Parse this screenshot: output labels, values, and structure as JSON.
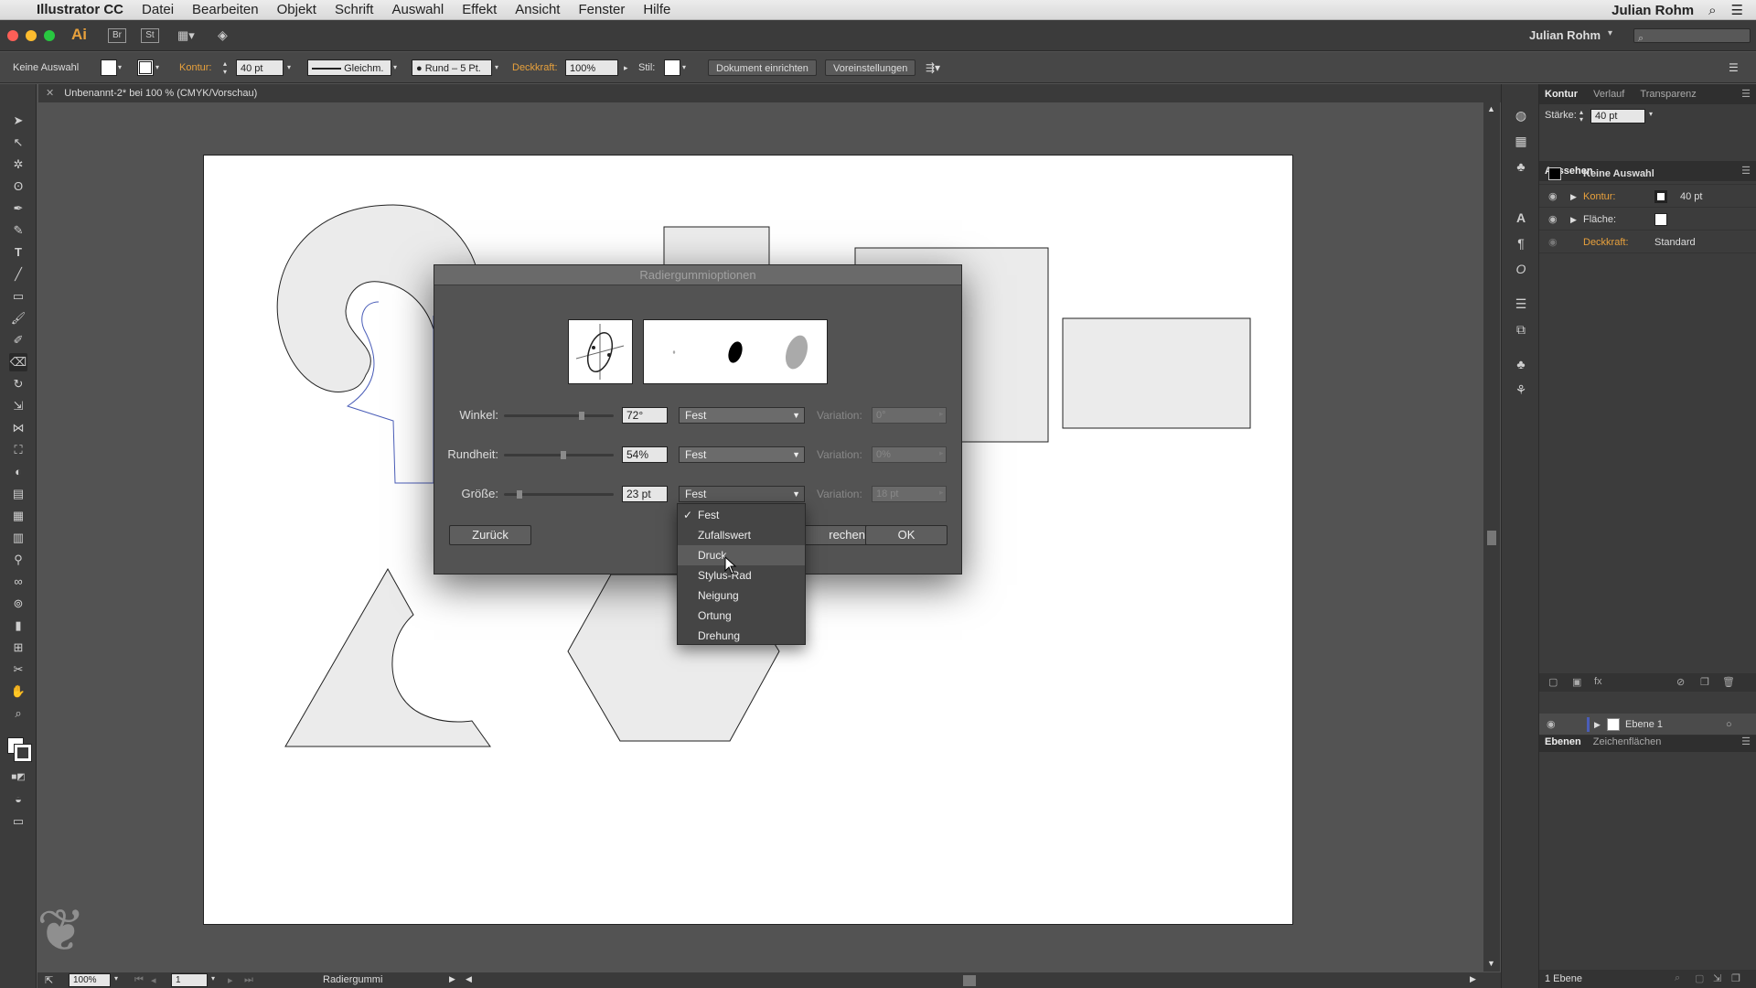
{
  "menubar": {
    "app_name": "Illustrator CC",
    "items": [
      "Datei",
      "Bearbeiten",
      "Objekt",
      "Schrift",
      "Auswahl",
      "Effekt",
      "Ansicht",
      "Fenster",
      "Hilfe"
    ],
    "user": "Julian Rohm"
  },
  "appbar": {
    "logo": "Ai",
    "br": "Br",
    "st": "St",
    "user": "Julian Rohm"
  },
  "control_bar": {
    "selection": "Keine Auswahl",
    "kontur_label": "Kontur:",
    "kontur_value": "40 pt",
    "profile": "Gleichm.",
    "brush": "Rund – 5 Pt.",
    "deckkraft_label": "Deckkraft:",
    "deckkraft_value": "100%",
    "stil_label": "Stil:",
    "doc_setup": "Dokument einrichten",
    "prefs": "Voreinstellungen"
  },
  "doc_tab": {
    "title": "Unbenannt-2* bei 100 % (CMYK/Vorschau)"
  },
  "dialog": {
    "title": "Radiergummioptionen",
    "winkel_label": "Winkel:",
    "winkel_value": "72°",
    "winkel_mode": "Fest",
    "rundheit_label": "Rundheit:",
    "rundheit_value": "54%",
    "rundheit_mode": "Fest",
    "groesse_label": "Größe:",
    "groesse_value": "23 pt",
    "groesse_mode": "Fest",
    "variation_label": "Variation:",
    "var1": "0°",
    "var2": "0%",
    "var3": "18 pt",
    "back_button": "Zurück",
    "cancel_button": "rechen",
    "ok_button": "OK",
    "winkel_slider": 0.72,
    "rundheit_slider": 0.54,
    "groesse_slider": 0.12
  },
  "dropdown": {
    "options": [
      "Fest",
      "Zufallswert",
      "Druck",
      "Stylus-Rad",
      "Neigung",
      "Ortung",
      "Drehung"
    ],
    "selected": "Fest",
    "hovered": "Druck"
  },
  "panels": {
    "kontur_tab": "Kontur",
    "verlauf_tab": "Verlauf",
    "transparenz_tab": "Transparenz",
    "staerke_label": "Stärke:",
    "staerke_value": "40 pt",
    "aussehen_title": "Aussehen",
    "keine_auswahl": "Keine Auswahl",
    "kontur_row": "Kontur:",
    "kontur_row_value": "40 pt",
    "flaeche_row": "Fläche:",
    "deckkraft_row": "Deckkraft:",
    "deckkraft_row_value": "Standard",
    "ebenen_tab": "Ebenen",
    "zeichenflaechen_tab": "Zeichenflächen",
    "layer_name": "Ebene 1",
    "layer_count": "1 Ebene"
  },
  "statusbar": {
    "zoom": "100%",
    "page": "1",
    "tool": "Radiergummi"
  },
  "colors": {
    "accent_orange": "#e8a13c",
    "ui_dark": "#3c3c3c",
    "ui_bg": "#535353"
  }
}
